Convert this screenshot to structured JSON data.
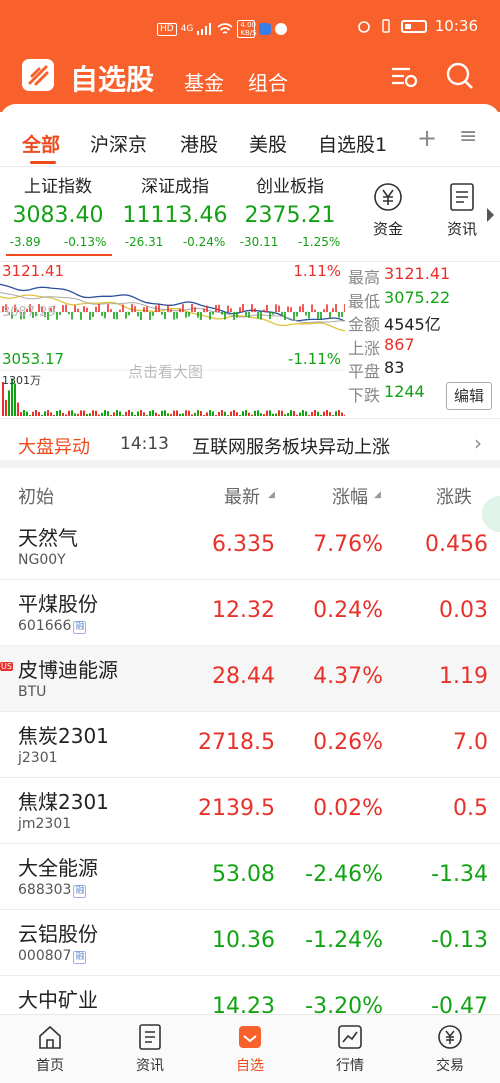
{
  "status_bar": {
    "net1": "HD",
    "net2": "4G",
    "speed": "4.00\nKB/S",
    "time": "10:36"
  },
  "header": {
    "title": "自选股",
    "links": [
      "基金",
      "组合"
    ]
  },
  "tabs": [
    "全部",
    "沪深京",
    "港股",
    "美股",
    "自选股1"
  ],
  "indices": [
    {
      "name": "上证指数",
      "value": "3083.40",
      "chg": "-3.89",
      "pct": "-0.13%"
    },
    {
      "name": "深证成指",
      "value": "11113.46",
      "chg": "-26.31",
      "pct": "-0.24%"
    },
    {
      "name": "创业板指",
      "value": "2375.21",
      "chg": "-30.11",
      "pct": "-1.25%"
    }
  ],
  "quick": [
    {
      "label": "资金",
      "icon": "yuan-icon"
    },
    {
      "label": "资讯",
      "icon": "news-icon"
    }
  ],
  "chart": {
    "high": "3121.41",
    "high_pct": "1.11%",
    "low": "3053.17",
    "low_pct": "-1.11%",
    "mid_faded": "3087.29",
    "volume": "1301万",
    "hint": "点击看大图",
    "stats": [
      {
        "k": "最高",
        "v": "3121.41",
        "c": "up"
      },
      {
        "k": "最低",
        "v": "3075.22",
        "c": "dn"
      },
      {
        "k": "金额",
        "v": "4545亿",
        "c": "nt"
      },
      {
        "k": "上涨",
        "v": "867",
        "c": "up"
      },
      {
        "k": "平盘",
        "v": "83",
        "c": "nt"
      },
      {
        "k": "下跌",
        "v": "1244",
        "c": "dn"
      }
    ],
    "edit": "编辑"
  },
  "alert": {
    "label": "大盘异动",
    "time": "14:13",
    "msg": "互联网服务板块异动上涨"
  },
  "list_header": [
    "初始",
    "最新",
    "涨幅",
    "涨跌"
  ],
  "stocks": [
    {
      "name": "天然气",
      "code": "NG00Y",
      "rz": false,
      "us": false,
      "price": "6.335",
      "pct": "7.76%",
      "chg": "0.456",
      "dir": "up"
    },
    {
      "name": "平煤股份",
      "code": "601666",
      "rz": true,
      "us": false,
      "price": "12.32",
      "pct": "0.24%",
      "chg": "0.03",
      "dir": "up"
    },
    {
      "name": "皮博迪能源",
      "code": "BTU",
      "rz": false,
      "us": true,
      "price": "28.44",
      "pct": "4.37%",
      "chg": "1.19",
      "dir": "up"
    },
    {
      "name": "焦炭2301",
      "code": "j2301",
      "rz": false,
      "us": false,
      "price": "2718.5",
      "pct": "0.26%",
      "chg": "7.0",
      "dir": "up"
    },
    {
      "name": "焦煤2301",
      "code": "jm2301",
      "rz": false,
      "us": false,
      "price": "2139.5",
      "pct": "0.02%",
      "chg": "0.5",
      "dir": "up"
    },
    {
      "name": "大全能源",
      "code": "688303",
      "rz": true,
      "us": false,
      "price": "53.08",
      "pct": "-2.46%",
      "chg": "-1.34",
      "dir": "dn"
    },
    {
      "name": "云铝股份",
      "code": "000807",
      "rz": true,
      "us": false,
      "price": "10.36",
      "pct": "-1.24%",
      "chg": "-0.13",
      "dir": "dn"
    },
    {
      "name": "大中矿业",
      "code": "",
      "rz": false,
      "us": false,
      "price": "14.23",
      "pct": "-3.20%",
      "chg": "-0.47",
      "dir": "dn"
    }
  ],
  "rz_tag": "融",
  "us_tag": "US",
  "nav": [
    {
      "label": "首页",
      "icon": "home-icon"
    },
    {
      "label": "资讯",
      "icon": "news-icon"
    },
    {
      "label": "自选",
      "icon": "watchlist-icon"
    },
    {
      "label": "行情",
      "icon": "market-icon"
    },
    {
      "label": "交易",
      "icon": "trade-icon"
    }
  ]
}
